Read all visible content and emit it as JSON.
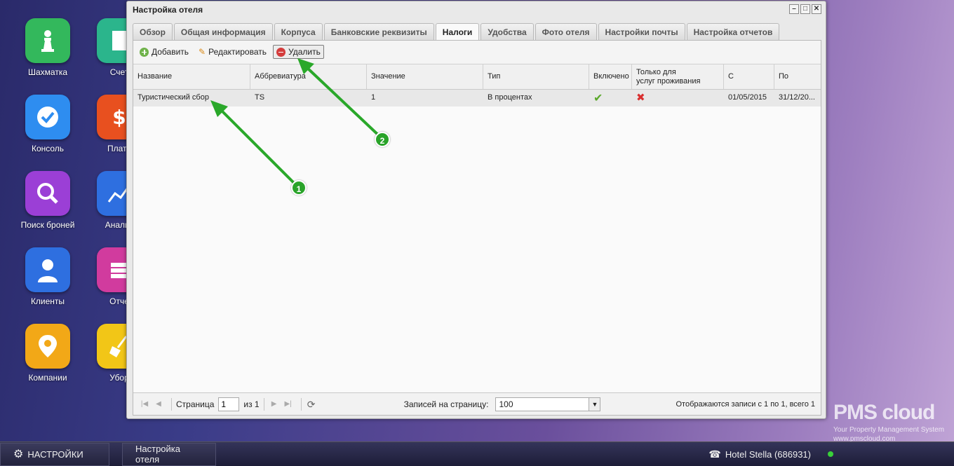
{
  "desktop": {
    "icons": [
      {
        "label": "Шахматка",
        "color": "#33b85c"
      },
      {
        "label": "Консоль",
        "color": "#2e8df0"
      },
      {
        "label": "Поиск броней",
        "color": "#9b3fd6"
      },
      {
        "label": "Клиенты",
        "color": "#2e6fe0"
      },
      {
        "label": "Компании",
        "color": "#f2a817"
      }
    ],
    "icons2": [
      {
        "label": "Счет",
        "color": "#2bb58c"
      },
      {
        "label": "Плате",
        "color": "#e8501f"
      },
      {
        "label": "Аналит",
        "color": "#2e6fe0"
      },
      {
        "label": "Отче",
        "color": "#d13b9e"
      },
      {
        "label": "Убор",
        "color": "#f2c617"
      }
    ]
  },
  "window": {
    "title": "Настройка отеля",
    "controls": [
      "–",
      "□",
      "✕"
    ],
    "tabs": [
      "Обзор",
      "Общая информация",
      "Корпуса",
      "Банковские реквизиты",
      "Налоги",
      "Удобства",
      "Фото отеля",
      "Настройки почты",
      "Настройка отчетов"
    ],
    "active_tab": "Налоги"
  },
  "toolbar": {
    "add_label": "Добавить",
    "edit_label": "Редактировать",
    "delete_label": "Удалить"
  },
  "grid": {
    "columns": [
      "Название",
      "Аббревиатура",
      "Значение",
      "Тип",
      "Включено в",
      "Только для\nуслуг проживания",
      "С",
      "По"
    ],
    "rows": [
      {
        "name": "Туристический сбор",
        "abbr": "TS",
        "value": "1",
        "type": "В процентах",
        "enabled": "check",
        "only_accommodation": "cross",
        "from": "01/05/2015",
        "to": "31/12/20..."
      }
    ]
  },
  "pager": {
    "page_label": "Страница",
    "page_value": "1",
    "of_label": "из 1",
    "per_page_label": "Записей на страницу:",
    "per_page_value": "100",
    "summary": "Отображаются записи с 1 по 1, всего 1"
  },
  "annotations": [
    "1",
    "2"
  ],
  "taskbar": {
    "settings_label": "НАСТРОЙКИ",
    "window_label": "Настройка отеля",
    "hotel": "Hotel Stella (686931)"
  },
  "logo": {
    "brand": "PMS cloud",
    "tagline": "Your Property Management System",
    "url": "www.pmscloud.com"
  }
}
